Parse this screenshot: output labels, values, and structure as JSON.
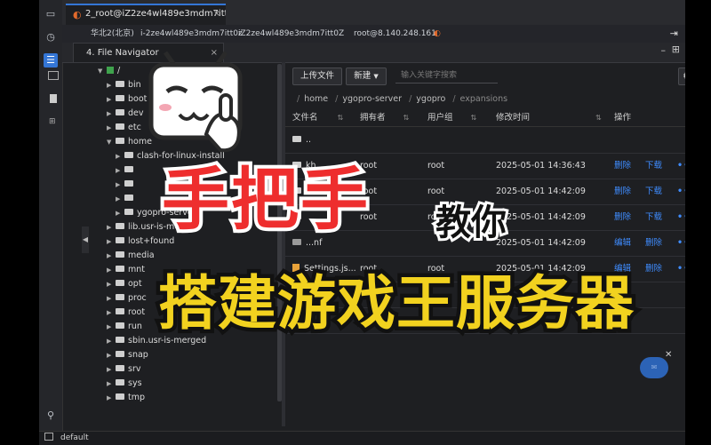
{
  "window": {
    "tab_title": "2_root@iZ2ze4wl489e3mdm7itt0...",
    "conn_region": "华北2(北京)",
    "conn_instance": "i-2ze4wl489e3mdm7itt0z",
    "conn_host": "iZ2ze4wl489e3mdm7itt0Z",
    "conn_ip": "root@8.140.248.161"
  },
  "file_navigator": {
    "tab_label": "4. File Navigator",
    "tree": [
      {
        "label": "/",
        "depth": 0,
        "expanded": true
      },
      {
        "label": "bin",
        "depth": 1
      },
      {
        "label": "boot",
        "depth": 1
      },
      {
        "label": "dev",
        "depth": 1
      },
      {
        "label": "etc",
        "depth": 1
      },
      {
        "label": "home",
        "depth": 1,
        "expanded": true
      },
      {
        "label": "clash-for-linux-install",
        "depth": 2
      },
      {
        "label": "",
        "depth": 2
      },
      {
        "label": "",
        "depth": 2
      },
      {
        "label": "",
        "depth": 2
      },
      {
        "label": "ygopro-server",
        "depth": 2
      },
      {
        "label": "lib.usr-is-merged",
        "depth": 1
      },
      {
        "label": "lost+found",
        "depth": 1
      },
      {
        "label": "media",
        "depth": 1
      },
      {
        "label": "mnt",
        "depth": 1
      },
      {
        "label": "opt",
        "depth": 1
      },
      {
        "label": "proc",
        "depth": 1
      },
      {
        "label": "root",
        "depth": 1
      },
      {
        "label": "run",
        "depth": 1
      },
      {
        "label": "sbin.usr-is-merged",
        "depth": 1
      },
      {
        "label": "snap",
        "depth": 1
      },
      {
        "label": "srv",
        "depth": 1
      },
      {
        "label": "sys",
        "depth": 1
      },
      {
        "label": "tmp",
        "depth": 1
      }
    ]
  },
  "toolbar": {
    "upload_label": "上传文件",
    "new_label": "新建",
    "search_placeholder": "输入关键字搜索"
  },
  "breadcrumb": [
    "home",
    "ygopro-server",
    "ygopro",
    "expansions"
  ],
  "table": {
    "headers": [
      "文件名",
      "拥有者",
      "用户组",
      "修改时间",
      "操作"
    ],
    "rows": [
      {
        "name": "..",
        "owner": "",
        "group": "",
        "mtime": "",
        "kind": "folder",
        "a1": "",
        "a2": ""
      },
      {
        "name": "kh",
        "owner": "root",
        "group": "root",
        "mtime": "2025-05-01 14:36:43",
        "kind": "folder",
        "a1": "删除",
        "a2": "下载"
      },
      {
        "name": "",
        "owner": "root",
        "group": "root",
        "mtime": "2025-05-01 14:42:09",
        "kind": "folder",
        "a1": "删除",
        "a2": "下载"
      },
      {
        "name": "",
        "owner": "root",
        "group": "root",
        "mtime": "2025-05-01 14:42:09",
        "kind": "folder",
        "a1": "删除",
        "a2": "下载"
      },
      {
        "name": "...nf",
        "owner": "",
        "group": "",
        "mtime": "2025-05-01 14:42:09",
        "kind": "file",
        "a1": "编辑",
        "a2": "删除"
      },
      {
        "name": "Settings.js...",
        "owner": "root",
        "group": "root",
        "mtime": "2025-05-01 14:42:09",
        "kind": "json",
        "a1": "编辑",
        "a2": "删除"
      },
      {
        "name": "",
        "owner": "",
        "group": "",
        "mtime": "",
        "kind": "file",
        "a1": "",
        "a2": ""
      },
      {
        "name": "",
        "owner": "",
        "group": "",
        "mtime": "",
        "kind": "file",
        "a1": "",
        "a2": ""
      }
    ]
  },
  "status": {
    "session": "default"
  },
  "overlay": {
    "line1": "手把手",
    "line1b": "教你",
    "line2": "搭建游戏王服务器"
  },
  "colors": {
    "accent": "#3476d6",
    "link": "#3f8cff",
    "red": "#ee2e2e",
    "yellow": "#f2d21f"
  }
}
